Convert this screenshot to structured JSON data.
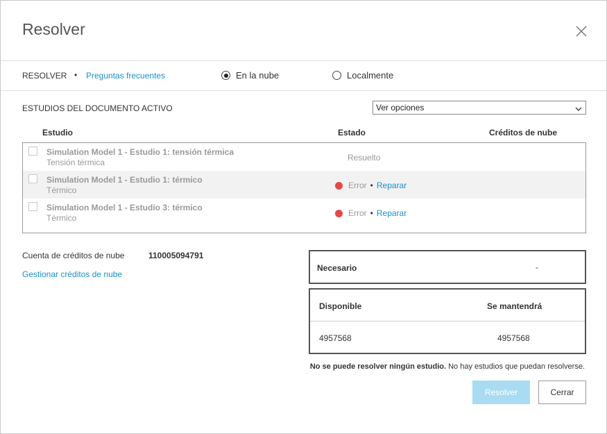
{
  "dialog": {
    "title": "Resolver",
    "close_icon": "close-icon"
  },
  "subbar": {
    "resolve_label": "RESOLVER",
    "separator": "•",
    "faq_link": "Preguntas frecuentes",
    "options": [
      {
        "label": "En la nube",
        "selected": true
      },
      {
        "label": "Localmente",
        "selected": false
      }
    ]
  },
  "studies": {
    "section_label": "ESTUDIOS DEL DOCUMENTO ACTIVO",
    "select_value": "Ver opciones",
    "columns": [
      "Estudio",
      "Estado",
      "Créditos de nube"
    ],
    "rows": [
      {
        "title": "Simulation Model 1 - Estudio 1: tensión térmica",
        "subtitle": "Tensión térmica",
        "status": "Resuelto",
        "has_error": false,
        "action": ""
      },
      {
        "title": "Simulation Model 1 - Estudio 1: térmico",
        "subtitle": "Térmico",
        "status": "Error",
        "has_error": true,
        "action": "Reparar"
      },
      {
        "title": "Simulation Model 1 - Estudio 3: térmico",
        "subtitle": "Térmico",
        "status": "Error",
        "has_error": true,
        "action": "Reparar"
      }
    ]
  },
  "credits": {
    "account_label": "Cuenta de créditos de nube",
    "account_value": "110005094791",
    "manage_link": "Gestionar créditos de nube",
    "required_label": "Necesario",
    "required_value": "-",
    "available_label": "Disponible",
    "remaining_label": "Se mantendrá",
    "available_value": "4957568",
    "remaining_value": "4957568"
  },
  "footer": {
    "message_bold": "No se puede resolver ningún estudio.",
    "message_rest": " No hay estudios que puedan resolverse.",
    "resolve_button": "Resolver",
    "close_button": "Cerrar"
  },
  "colors": {
    "link": "#1b8fc9",
    "error_dot": "#e54848",
    "resolve_disabled": "#a9dcf2"
  }
}
